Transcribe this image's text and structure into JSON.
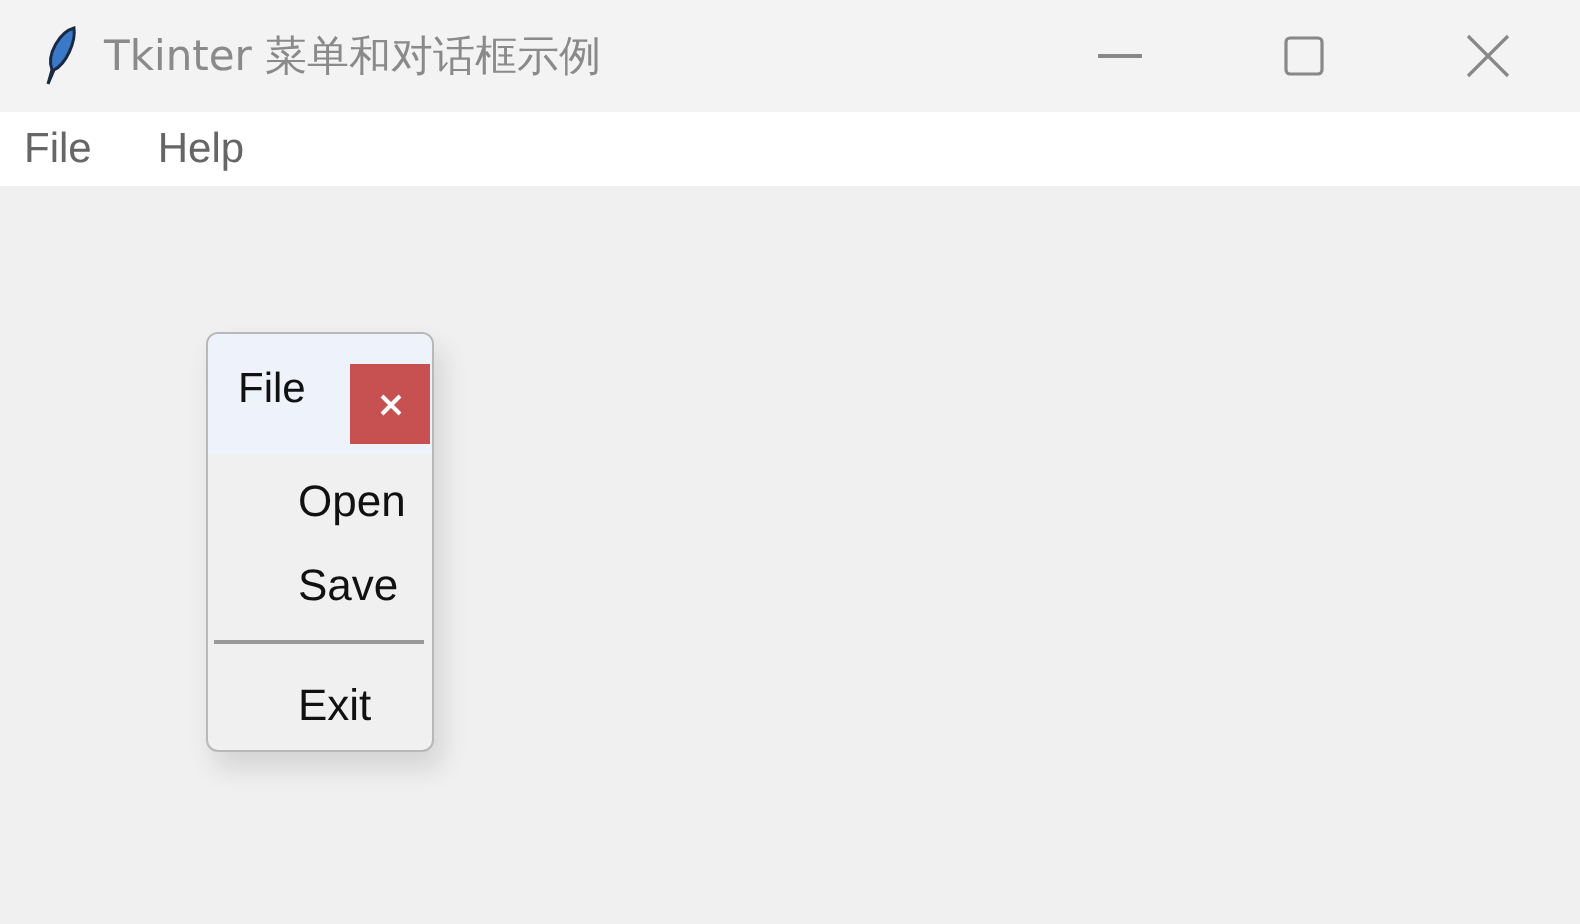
{
  "window": {
    "title": "Tkinter 菜单和对话框示例"
  },
  "menubar": [
    {
      "label": "File"
    },
    {
      "label": "Help"
    }
  ],
  "tearoff_menu": {
    "title": "File",
    "items": [
      {
        "kind": "command",
        "label": "Open"
      },
      {
        "kind": "command",
        "label": "Save"
      },
      {
        "kind": "separator"
      },
      {
        "kind": "command",
        "label": "Exit"
      }
    ]
  }
}
